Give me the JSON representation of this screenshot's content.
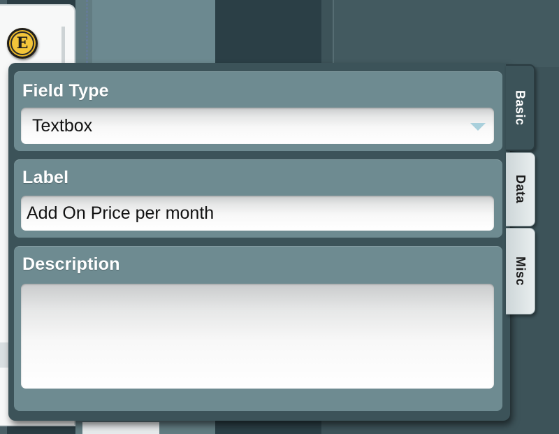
{
  "badge": {
    "letter": "E"
  },
  "form": {
    "field_type": {
      "title": "Field Type",
      "selected_value": "Textbox"
    },
    "label": {
      "title": "Label",
      "value": "Add On Price per month"
    },
    "description": {
      "title": "Description",
      "value": ""
    }
  },
  "tabs": [
    {
      "label": "Basic",
      "active": true
    },
    {
      "label": "Data",
      "active": false
    },
    {
      "label": "Misc",
      "active": false
    }
  ],
  "icons": {
    "badge": "e-badge-icon",
    "dropdown": "chevron-down-icon"
  },
  "colors": {
    "panel_bg": "#3c5359",
    "section_bg": "#6e8b91",
    "badge_gold": "#f3c53a",
    "dropdown_arrow": "#a9d0dc"
  }
}
